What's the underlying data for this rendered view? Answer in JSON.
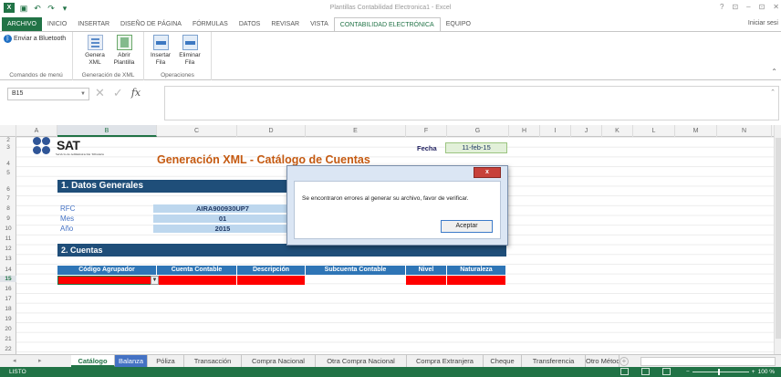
{
  "window": {
    "title": "Plantillas Contabilidad Electronica1 - Excel",
    "controls": [
      "?",
      "⊡",
      "–",
      "⊡",
      "✕"
    ],
    "sign_in": "Iniciar sesi"
  },
  "ribbon_tabs": [
    "ARCHIVO",
    "INICIO",
    "INSERTAR",
    "DISEÑO DE PÁGINA",
    "FÓRMULAS",
    "DATOS",
    "REVISAR",
    "VISTA",
    "CONTABILIDAD ELECTRÓNICA",
    "EQUIPO"
  ],
  "active_tab": "CONTABILIDAD ELECTRÓNICA",
  "ribbon": {
    "group_menu": {
      "button": "Enviar a Bluetooth",
      "name": "Comandos de menú"
    },
    "group_xml": {
      "buttons": [
        {
          "label": "Genera\nXML",
          "icon": "xml-file-icon"
        },
        {
          "label": "Abrir\nPlantilla",
          "icon": "open-template-icon"
        }
      ],
      "name": "Generación de XML"
    },
    "group_ops": {
      "buttons": [
        {
          "label": "Insertar\nFila",
          "icon": "insert-row-icon"
        },
        {
          "label": "Eliminar\nFila",
          "icon": "delete-row-icon"
        }
      ],
      "name": "Operaciones"
    }
  },
  "formula_bar": {
    "name_box": "B15",
    "formula": "",
    "icons": [
      "✕",
      "✓",
      "fx"
    ]
  },
  "columns": [
    "A",
    "B",
    "C",
    "D",
    "E",
    "F",
    "G",
    "H",
    "I",
    "J",
    "K",
    "L",
    "M",
    "N"
  ],
  "selected_column": "B",
  "rows": [
    "2",
    "3",
    "4",
    "5",
    "6",
    "7",
    "8",
    "9",
    "10",
    "11",
    "12",
    "13",
    "14",
    "15",
    "16",
    "17",
    "18",
    "19",
    "20",
    "21",
    "22"
  ],
  "selected_row": "15",
  "sheet": {
    "logo": {
      "word": "SAT",
      "subtitle": "Servicio de Administración Tributaria"
    },
    "title": "Generación XML - Catálogo de Cuentas",
    "fecha_label": "Fecha",
    "fecha_value": "11-feb-15",
    "section1": "1. Datos Generales",
    "fields": [
      {
        "label": "RFC",
        "value": "AIRA900930UP7"
      },
      {
        "label": "Mes",
        "value": "01"
      },
      {
        "label": "Año",
        "value": "2015"
      }
    ],
    "section2": "2. Cuentas",
    "table_headers": [
      "Código Agrupador",
      "Cuenta Contable",
      "Descripción",
      "Subcuenta Contable",
      "Nivel",
      "Naturaleza"
    ]
  },
  "dialog": {
    "close_label": "x",
    "message": "Se encontraron errores al generar su archivo, favor de verificar.",
    "button": "Aceptar"
  },
  "sheet_tabs": [
    "Catálogo",
    "Balanza",
    "Póliza",
    "Transacción",
    "Compra Nacional",
    "Otra Compra Nacional",
    "Compra Extranjera",
    "Cheque",
    "Transferencia",
    "Otro Método ..."
  ],
  "active_sheet": "Catálogo",
  "status": {
    "ready": "LISTO",
    "zoom": "100 %"
  },
  "colors": {
    "excel_green": "#217346",
    "header_blue": "#1f4e79",
    "table_blue": "#2e75b6",
    "title_orange": "#c55a11",
    "error_red": "#ff0000"
  }
}
